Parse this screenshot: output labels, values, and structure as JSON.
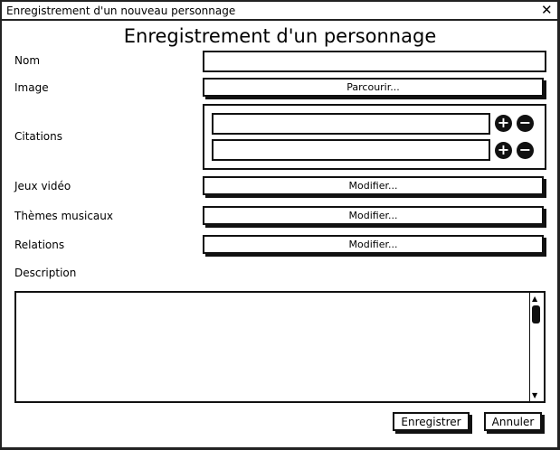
{
  "window": {
    "title": "Enregistrement d'un nouveau personnage",
    "close_icon": "close-icon"
  },
  "heading": "Enregistrement d'un personnage",
  "fields": {
    "nom": {
      "label": "Nom",
      "value": ""
    },
    "image": {
      "label": "Image",
      "button": "Parcourir..."
    },
    "citations": {
      "label": "Citations",
      "items": [
        "",
        ""
      ]
    },
    "jeux": {
      "label": "Jeux vidéo",
      "button": "Modifier..."
    },
    "themes": {
      "label": "Thèmes musicaux",
      "button": "Modifier..."
    },
    "relations": {
      "label": "Relations",
      "button": "Modifier..."
    },
    "description": {
      "label": "Description",
      "value": ""
    }
  },
  "actions": {
    "save": "Enregistrer",
    "cancel": "Annuler"
  }
}
